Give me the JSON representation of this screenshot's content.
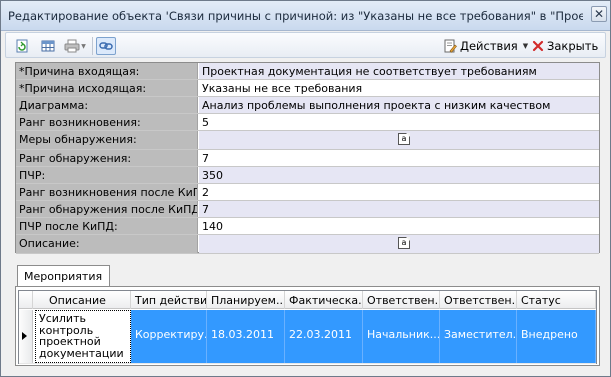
{
  "window": {
    "title": "Редактирование объекта 'Связи причины с причиной: из \"Указаны не все требования\" в \"Проектная ...",
    "close_glyph": "✕"
  },
  "toolbar": {
    "buttons": [
      {
        "name": "refresh-button",
        "icon": "refresh-icon"
      },
      {
        "name": "table-view-button",
        "icon": "table-icon"
      },
      {
        "name": "print-button",
        "icon": "printer-icon"
      },
      {
        "name": "link-button",
        "icon": "link-icon"
      }
    ],
    "actions_label": "Действия",
    "close_label": "Закрыть"
  },
  "properties": [
    {
      "label": "*Причина входящая:",
      "value": "Проектная документация не соответствует требованиям",
      "memo": false
    },
    {
      "label": "*Причина исходящая:",
      "value": "Указаны не все требования",
      "memo": false
    },
    {
      "label": "Диаграмма:",
      "value": "Анализ проблемы выполнения проекта с низким качеством",
      "memo": false
    },
    {
      "label": "Ранг возникновения:",
      "value": "5",
      "memo": false
    },
    {
      "label": "Меры обнаружения:",
      "value": "",
      "memo": true
    },
    {
      "label": "Ранг обнаружения:",
      "value": "7",
      "memo": false
    },
    {
      "label": "ПЧР:",
      "value": "350",
      "memo": false
    },
    {
      "label": "Ранг возникновения после КиПД:",
      "value": "2",
      "memo": false
    },
    {
      "label": "Ранг обнаружения после КиПД:",
      "value": "7",
      "memo": false
    },
    {
      "label": "ПЧР после КиПД:",
      "value": "140",
      "memo": false
    },
    {
      "label": "Описание:",
      "value": "",
      "memo": true
    }
  ],
  "memo_glyph": "a",
  "tabs": [
    {
      "label": "Мероприятия",
      "active": true
    }
  ],
  "grid": {
    "columns": [
      "Описание",
      "Тип действия",
      "Планируем...",
      "Фактическа...",
      "Ответствен...",
      "Ответствен...",
      "Статус"
    ],
    "rows": [
      [
        "Усилить контроль проектной документации",
        "Корректиру...",
        "18.03.2011",
        "22.03.2011",
        "Начальник...",
        "Заместител...",
        "Внедрено"
      ]
    ]
  }
}
